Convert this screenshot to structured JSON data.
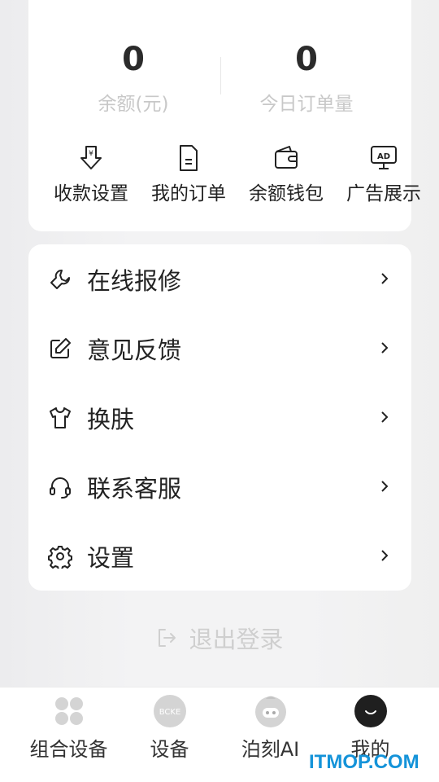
{
  "stats": {
    "balance_value": "0",
    "balance_label": "余额(元)",
    "orders_value": "0",
    "orders_label": "今日订单量"
  },
  "quick_actions": [
    {
      "label": "收款设置",
      "icon": "payment-download-icon"
    },
    {
      "label": "我的订单",
      "icon": "document-icon"
    },
    {
      "label": "余额钱包",
      "icon": "wallet-icon"
    },
    {
      "label": "广告展示",
      "icon": "ad-monitor-icon"
    }
  ],
  "menu": [
    {
      "label": "在线报修",
      "icon": "wrench-icon"
    },
    {
      "label": "意见反馈",
      "icon": "edit-icon"
    },
    {
      "label": "换肤",
      "icon": "shirt-icon"
    },
    {
      "label": "联系客服",
      "icon": "headset-icon"
    },
    {
      "label": "设置",
      "icon": "gear-icon"
    }
  ],
  "logout": {
    "label": "退出登录",
    "icon": "logout-icon"
  },
  "tabbar": [
    {
      "label": "组合设备",
      "icon": "four-circles-icon",
      "active": false
    },
    {
      "label": "设备",
      "icon": "device-badge-icon",
      "badge_text": "BCKE",
      "active": false
    },
    {
      "label": "泊刻AI",
      "icon": "robot-icon",
      "active": false
    },
    {
      "label": "我的",
      "icon": "profile-smile-icon",
      "active": true
    }
  ],
  "watermark": "ITMOP.COM",
  "colors": {
    "watermark": "#1493d9",
    "muted_text": "#c8c8c8",
    "text": "#222222"
  }
}
